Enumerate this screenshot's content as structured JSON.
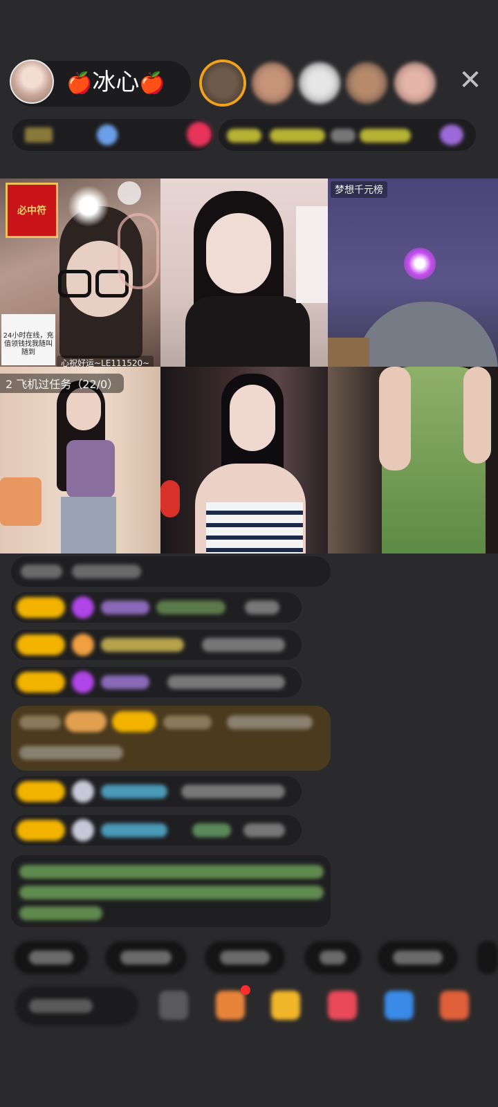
{
  "host": {
    "name_prefix": "🍎",
    "name": "冰心",
    "name_suffix": "🍎"
  },
  "top_icons": {
    "close_label": "✕"
  },
  "grid": {
    "tile1_badge": "必中符",
    "tile1_promo": "24小时在线，充值领钱找我随叫随到",
    "tile1_bottom_label": "心祝好运~LE111520~",
    "tile3_label": "梦想千元榜",
    "tile4_task": "2 飞机过任务（22/0）"
  },
  "colors": {
    "background": "#2a2a2c",
    "level_badge": "#f2b400",
    "accent_orange": "#f0a21a",
    "chat_green_text": "#7ec86a"
  }
}
